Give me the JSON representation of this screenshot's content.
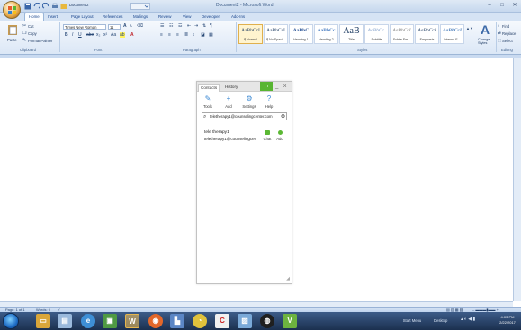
{
  "window": {
    "title": "Document2 - Microsoft Word",
    "quick_access_doc": "Document2"
  },
  "tabs": [
    "Home",
    "Insert",
    "Page Layout",
    "References",
    "Mailings",
    "Review",
    "View",
    "Developer",
    "Add-Ins"
  ],
  "ribbon": {
    "clipboard": {
      "paste": "Paste",
      "cut": "Cut",
      "copy": "Copy",
      "format_painter": "Format Painter",
      "label": "Clipboard"
    },
    "font": {
      "name": "Times New Roman",
      "size": "11",
      "label": "Font"
    },
    "paragraph": {
      "label": "Paragraph"
    },
    "styles": {
      "label": "Styles",
      "items": [
        {
          "sample": "AaBbCcI",
          "name": "¶ Normal"
        },
        {
          "sample": "AaBbCcI",
          "name": "¶ No Spaci..."
        },
        {
          "sample": "AaBbC",
          "name": "Heading 1"
        },
        {
          "sample": "AaBbCc",
          "name": "Heading 2"
        },
        {
          "sample": "AaB",
          "name": "Title"
        },
        {
          "sample": "AaBbCc.",
          "name": "Subtitle"
        },
        {
          "sample": "AaBbCcI",
          "name": "Subtle Em..."
        },
        {
          "sample": "AaBbCcI",
          "name": "Emphasis"
        },
        {
          "sample": "AaBbCcI",
          "name": "Intense E..."
        }
      ],
      "change_styles": "Change Styles"
    },
    "editing": {
      "find": "Find",
      "replace": "Replace",
      "select": "Select",
      "label": "Editing"
    }
  },
  "widget": {
    "tabs": [
      "Contacts",
      "History"
    ],
    "badge": "TT",
    "controls": {
      "minimize": "_",
      "close": "X"
    },
    "tools": [
      {
        "icon": "tools-icon",
        "label": "Tools"
      },
      {
        "icon": "add-icon",
        "label": "Add"
      },
      {
        "icon": "settings-icon",
        "label": "Settings"
      },
      {
        "icon": "help-icon",
        "label": "Help"
      }
    ],
    "search": {
      "value": "teletherapy1@counselingcenter.com",
      "clear": "⊗"
    },
    "contact": {
      "name": "tele therapy1",
      "email": "teletherapy1@counselingcer",
      "actions": [
        "Chat",
        "Add"
      ]
    }
  },
  "status": {
    "page": "Page: 1 of 1",
    "words": "Words: 0"
  },
  "taskbar": {
    "notify": "Start Menu",
    "desktop": "Desktop",
    "time": "4:03 PM",
    "date": "2/22/2017",
    "apps": [
      "explorer",
      "document",
      "browser",
      "media",
      "word",
      "firefox",
      "people",
      "chrome",
      "ccleaner",
      "photos",
      "app-dark",
      "vtool"
    ]
  }
}
